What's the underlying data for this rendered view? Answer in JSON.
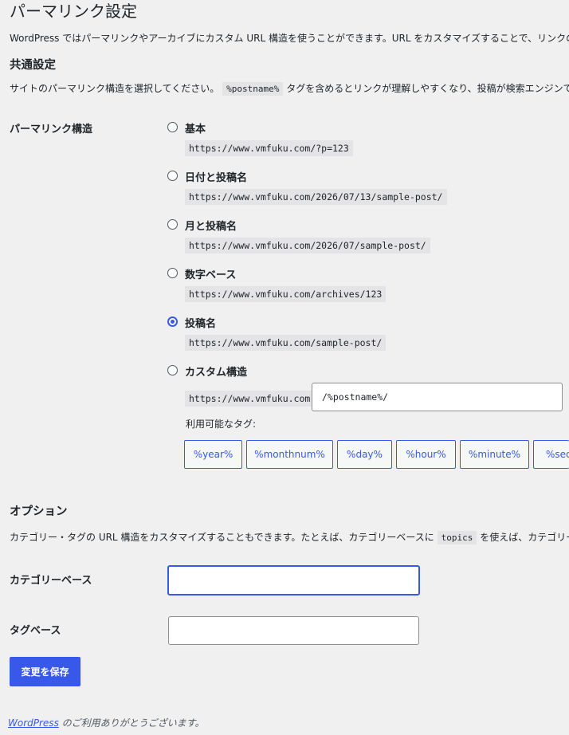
{
  "page": {
    "title": "パーマリンク設定",
    "intro": "WordPress ではパーマリンクやアーカイブにカスタム URL 構造を使うことができます。URL をカスタマイズすることで、リンクの美し"
  },
  "common": {
    "heading": "共通設定",
    "desc_before": "サイトのパーマリンク構造を選択してください。",
    "desc_code": "%postname%",
    "desc_after": "タグを含めるとリンクが理解しやすくなり、投稿が検索エンジンで上位"
  },
  "permalink": {
    "row_label": "パーマリンク構造",
    "options": [
      {
        "label": "基本",
        "url": "https://www.vmfuku.com/?p=123",
        "checked": false
      },
      {
        "label": "日付と投稿名",
        "url": "https://www.vmfuku.com/2026/07/13/sample-post/",
        "checked": false
      },
      {
        "label": "月と投稿名",
        "url": "https://www.vmfuku.com/2026/07/sample-post/",
        "checked": false
      },
      {
        "label": "数字ベース",
        "url": "https://www.vmfuku.com/archives/123",
        "checked": false
      },
      {
        "label": "投稿名",
        "url": "https://www.vmfuku.com/sample-post/",
        "checked": true
      }
    ],
    "custom": {
      "label": "カスタム構造",
      "prefix": "https://www.vmfuku.com",
      "value": "/%postname%/"
    },
    "available_tags_label": "利用可能なタグ:",
    "tags": [
      "%year%",
      "%monthnum%",
      "%day%",
      "%hour%",
      "%minute%",
      "%seco"
    ]
  },
  "options": {
    "heading": "オプション",
    "desc_before": "カテゴリー・タグの URL 構造をカスタマイズすることもできます。たとえば、カテゴリーベースに",
    "desc_code": "topics",
    "desc_after": "を使えば、カテゴリーの",
    "category_base_label": "カテゴリーベース",
    "category_base_value": "",
    "tag_base_label": "タグベース",
    "tag_base_value": ""
  },
  "save_label": "変更を保存",
  "footer": {
    "link": "WordPress",
    "text": " のご利用ありがとうございます。"
  },
  "colors": {
    "accent": "#3858e9",
    "background": "#f0f0f1",
    "text": "#1d2327"
  }
}
